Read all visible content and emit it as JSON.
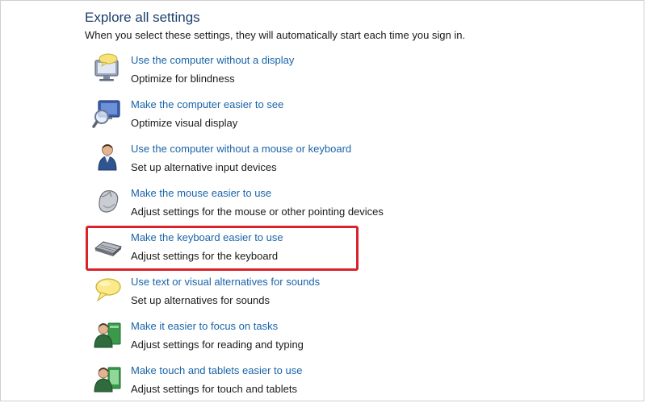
{
  "section": {
    "title": "Explore all settings",
    "description": "When you select these settings, they will automatically start each time you sign in."
  },
  "items": [
    {
      "icon": "monitor-speech-icon",
      "link": "Use the computer without a display",
      "description": "Optimize for blindness"
    },
    {
      "icon": "magnifier-display-icon",
      "link": "Make the computer easier to see",
      "description": "Optimize visual display"
    },
    {
      "icon": "person-icon",
      "link": "Use the computer without a mouse or keyboard",
      "description": "Set up alternative input devices"
    },
    {
      "icon": "mouse-icon",
      "link": "Make the mouse easier to use",
      "description": "Adjust settings for the mouse or other pointing devices"
    },
    {
      "icon": "keyboard-icon",
      "link": "Make the keyboard easier to use",
      "description": "Adjust settings for the keyboard"
    },
    {
      "icon": "speech-bubble-icon",
      "link": "Use text or visual alternatives for sounds",
      "description": "Set up alternatives for sounds"
    },
    {
      "icon": "person-focus-icon",
      "link": "Make it easier to focus on tasks",
      "description": "Adjust settings for reading and typing"
    },
    {
      "icon": "person-tablet-icon",
      "link": "Make touch and tablets easier to use",
      "description": "Adjust settings for touch and tablets"
    }
  ],
  "highlight": {
    "color": "#d9232a",
    "target": "Make the keyboard easier to use"
  },
  "colors": {
    "link": "#1a64a8",
    "title": "#1e3f6e",
    "text": "#1a1a1a"
  }
}
